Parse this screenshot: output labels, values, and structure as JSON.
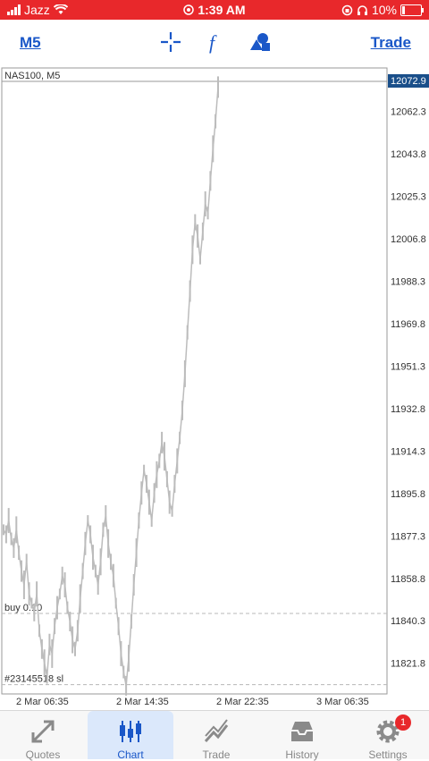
{
  "status": {
    "carrier": "Jazz",
    "time": "1:39 AM",
    "battery": "10%"
  },
  "toolbar": {
    "timeframe": "M5",
    "trade_label": "Trade",
    "icons": [
      "crosshair-icon",
      "function-icon",
      "objects-icon"
    ]
  },
  "chart": {
    "symbol_label": "NAS100, M5",
    "current_price": "12072.9",
    "price_labels": [
      "12062.3",
      "12043.8",
      "12025.3",
      "12006.8",
      "11988.3",
      "11969.8",
      "11951.3",
      "11932.8",
      "11914.3",
      "11895.8",
      "11877.3",
      "11858.8",
      "11840.3",
      "11821.8"
    ],
    "time_labels": [
      "2 Mar 06:35",
      "2 Mar 14:35",
      "2 Mar 22:35",
      "3 Mar 06:35"
    ],
    "position_label": "buy 0.10",
    "sl_label": "#23145518 sl",
    "colors": {
      "price_tag_bg": "#1a4f8a",
      "line": "#bcbcbc"
    }
  },
  "chart_data": {
    "type": "line",
    "y": [
      11880,
      11878,
      11884,
      11876,
      11872,
      11880,
      11870,
      11862,
      11856,
      11866,
      11852,
      11848,
      11844,
      11852,
      11836,
      11828,
      11822,
      11816,
      11830,
      11826,
      11838,
      11846,
      11852,
      11860,
      11856,
      11846,
      11840,
      11832,
      11828,
      11836,
      11850,
      11862,
      11874,
      11884,
      11878,
      11868,
      11862,
      11856,
      11866,
      11880,
      11886,
      11874,
      11866,
      11860,
      11848,
      11838,
      11826,
      11818,
      11812,
      11824,
      11840,
      11856,
      11870,
      11884,
      11896,
      11906,
      11900,
      11892,
      11884,
      11896,
      11904,
      11910,
      11918,
      11912,
      11902,
      11892,
      11888,
      11900,
      11910,
      11920,
      11932,
      11948,
      11966,
      11984,
      12002,
      12014,
      12008,
      11998,
      12010,
      12022,
      12018,
      12032,
      12046,
      12058,
      12072.9
    ],
    "ylim": [
      11810,
      12075
    ],
    "x_tick_labels": [
      "2 Mar 06:35",
      "2 Mar 14:35",
      "2 Mar 22:35",
      "3 Mar 06:35"
    ],
    "position_level": 11843.5,
    "sl_level": 11812.5
  },
  "nav": {
    "items": [
      {
        "label": "Quotes"
      },
      {
        "label": "Chart"
      },
      {
        "label": "Trade"
      },
      {
        "label": "History"
      },
      {
        "label": "Settings"
      }
    ],
    "settings_badge": "1"
  }
}
